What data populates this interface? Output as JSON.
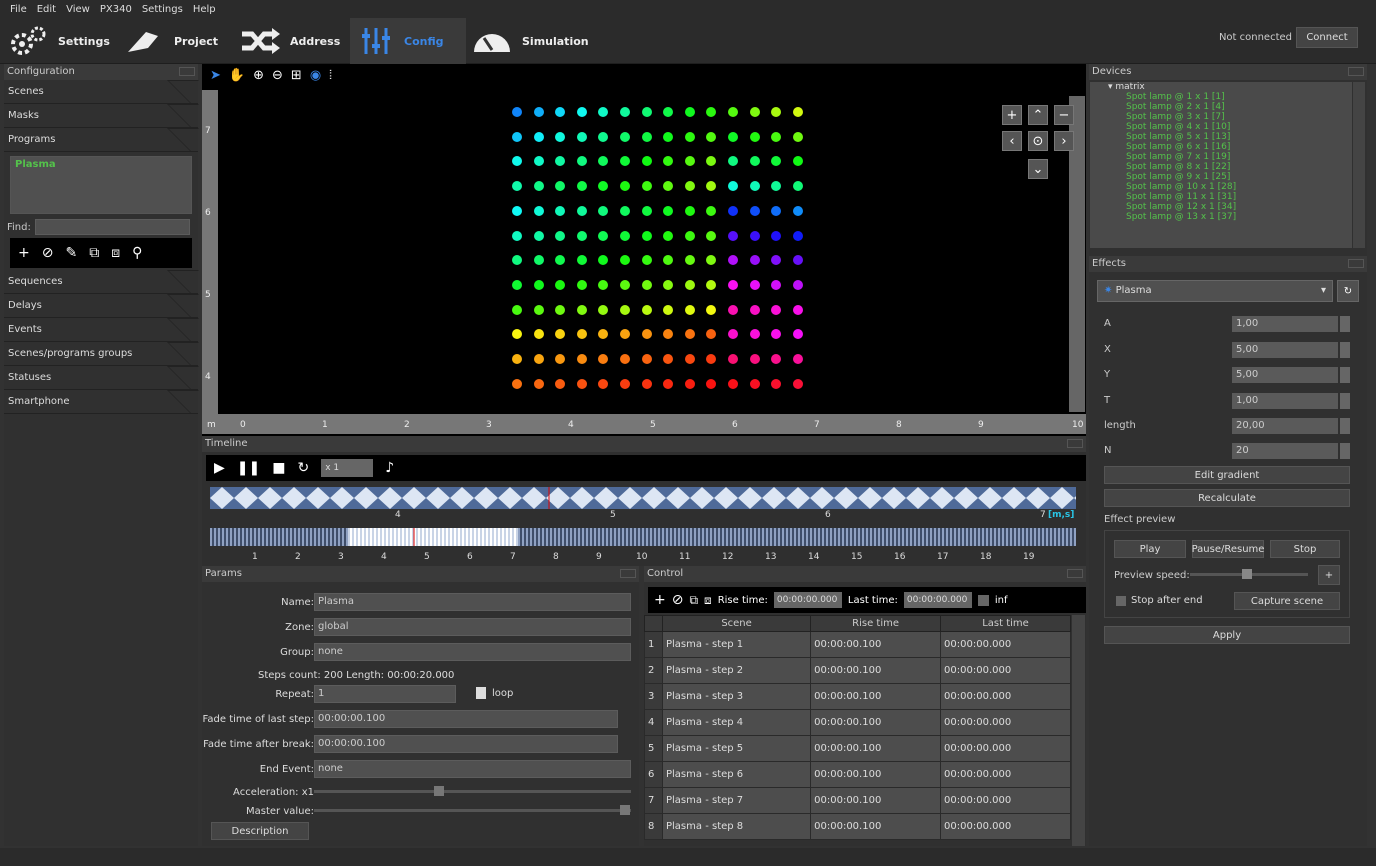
{
  "menu": [
    "File",
    "Edit",
    "View",
    "PX340",
    "Settings",
    "Help"
  ],
  "toolbar": {
    "settings": "Settings",
    "project": "Project",
    "address": "Address",
    "config": "Config",
    "simulation": "Simulation",
    "status": "Not connected",
    "connect": "Connect"
  },
  "left": {
    "title": "Configuration",
    "tabs_top": [
      "Scenes",
      "Masks",
      "Programs"
    ],
    "program": "Plasma",
    "find": "Find:",
    "tabs_bottom": [
      "Sequences",
      "Delays",
      "Events",
      "Scenes/programs groups",
      "Statuses",
      "Smartphone"
    ]
  },
  "ruler": {
    "m": "m",
    "h": [
      "0",
      "1",
      "2",
      "3",
      "4",
      "5",
      "6",
      "7",
      "8",
      "9",
      "10"
    ],
    "v": [
      "7",
      "6",
      "5",
      "4"
    ]
  },
  "timeline": {
    "title": "Timeline",
    "speed": "x 1",
    "t1": [
      "4",
      "5",
      "6",
      "7"
    ],
    "unit": "[m,s]",
    "t2": [
      "1",
      "2",
      "3",
      "4",
      "5",
      "6",
      "7",
      "8",
      "9",
      "10",
      "11",
      "12",
      "13",
      "14",
      "15",
      "16",
      "17",
      "18",
      "19"
    ]
  },
  "params": {
    "title": "Params",
    "name_l": "Name:",
    "name": "Plasma",
    "zone_l": "Zone:",
    "zone": "global",
    "group_l": "Group:",
    "group": "none",
    "steps": "Steps count: 200 Length: 00:00:20.000",
    "repeat_l": "Repeat:",
    "repeat": "1",
    "loop": "loop",
    "fade_l": "Fade time of last step:",
    "fade": "00:00:00.100",
    "fadeb_l": "Fade time after break:",
    "fadeb": "00:00:00.100",
    "end_l": "End Event:",
    "end": "none",
    "acc": "Acceleration: x1",
    "master": "Master value:",
    "desc": "Description"
  },
  "control": {
    "title": "Control",
    "rise_l": "Rise time:",
    "rise": "00:00:00.000",
    "last_l": "Last time:",
    "last": "00:00:00.000",
    "inf": "inf",
    "cols": [
      "Scene",
      "Rise time",
      "Last time"
    ],
    "rows": [
      [
        "1",
        "Plasma - step 1",
        "00:00:00.100",
        "00:00:00.000"
      ],
      [
        "2",
        "Plasma - step 2",
        "00:00:00.100",
        "00:00:00.000"
      ],
      [
        "3",
        "Plasma - step 3",
        "00:00:00.100",
        "00:00:00.000"
      ],
      [
        "4",
        "Plasma - step 4",
        "00:00:00.100",
        "00:00:00.000"
      ],
      [
        "5",
        "Plasma - step 5",
        "00:00:00.100",
        "00:00:00.000"
      ],
      [
        "6",
        "Plasma - step 6",
        "00:00:00.100",
        "00:00:00.000"
      ],
      [
        "7",
        "Plasma - step 7",
        "00:00:00.100",
        "00:00:00.000"
      ],
      [
        "8",
        "Plasma - step 8",
        "00:00:00.100",
        "00:00:00.000"
      ]
    ]
  },
  "devices": {
    "title": "Devices",
    "root": "matrix",
    "items": [
      "Spot lamp @ 1 x 1 [1]",
      "Spot lamp @ 2 x 1 [4]",
      "Spot lamp @ 3 x 1 [7]",
      "Spot lamp @ 4 x 1 [10]",
      "Spot lamp @ 5 x 1 [13]",
      "Spot lamp @ 6 x 1 [16]",
      "Spot lamp @ 7 x 1 [19]",
      "Spot lamp @ 8 x 1 [22]",
      "Spot lamp @ 9 x 1 [25]",
      "Spot lamp @ 10 x 1 [28]",
      "Spot lamp @ 11 x 1 [31]",
      "Spot lamp @ 12 x 1 [34]",
      "Spot lamp @ 13 x 1 [37]"
    ]
  },
  "effects": {
    "title": "Effects",
    "selected": "Plasma",
    "params": [
      [
        "A",
        "1,00"
      ],
      [
        "X",
        "5,00"
      ],
      [
        "Y",
        "5,00"
      ],
      [
        "T",
        "1,00"
      ],
      [
        "length",
        "20,00"
      ],
      [
        "N",
        "20"
      ]
    ],
    "edit": "Edit gradient",
    "recalc": "Recalculate",
    "preview": "Effect preview",
    "play": "Play",
    "pause": "Pause/Resume",
    "stop": "Stop",
    "speed": "Preview speed:",
    "stop_end": "Stop after end",
    "capture": "Capture scene",
    "apply": "Apply"
  }
}
